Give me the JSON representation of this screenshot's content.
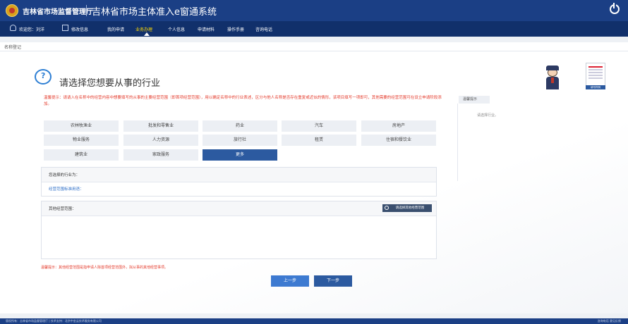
{
  "header": {
    "org_name": "吉林省市场监督管理厅",
    "system_title": "吉林省市场主体准入e窗通系统"
  },
  "nav": {
    "welcome": "欢迎您：刘洋",
    "edit_info": "修改信息",
    "items": [
      "我的申请",
      "业务办理",
      "个人信息",
      "申请材料",
      "操作手册",
      "咨询电话"
    ],
    "active": "业务办理"
  },
  "breadcrumb": "名称登记",
  "main": {
    "title": "请选择您想要从事的行业",
    "tip": "温馨提示：请请入在名称中的经营内容中想要填写的从事的主要经营范围（即首项经营范围），用以确定名称中的行业表述，区分与他人名称是否存在重复或近似的情形，该项目填写一项即可，其他需要的经营范围可在设立申请阶段添加。",
    "industries": [
      "农林牧渔业",
      "批发和零售业",
      "药业",
      "汽车",
      "房地产",
      "物业服务",
      "人力资源",
      "旅行社",
      "租赁",
      "住宿和餐饮业",
      "建筑业",
      "家政服务",
      "更多"
    ],
    "active_industry": "更多",
    "selected_label": "您选择的行业为：",
    "scope_label": "经营范围标准用语：",
    "other_scope_label": "其他经营范围：",
    "other_scope_button": "请选择其他经营范围",
    "warm_note": "温馨提示：其他经营范围是指申请人除首项经营范围外，拟从事的其他经营事项。",
    "prev_button": "上一步",
    "next_button": "下一步"
  },
  "sidebar": {
    "tab": "温馨提示",
    "hint": "请选择行业。",
    "doc_label": "填写样例"
  },
  "footer": {
    "left": "版权所有：吉林省市场监督管理厅 | 技术支持：北京中金云技术服务有限公司",
    "right": "咨询电话  意见反馈"
  }
}
